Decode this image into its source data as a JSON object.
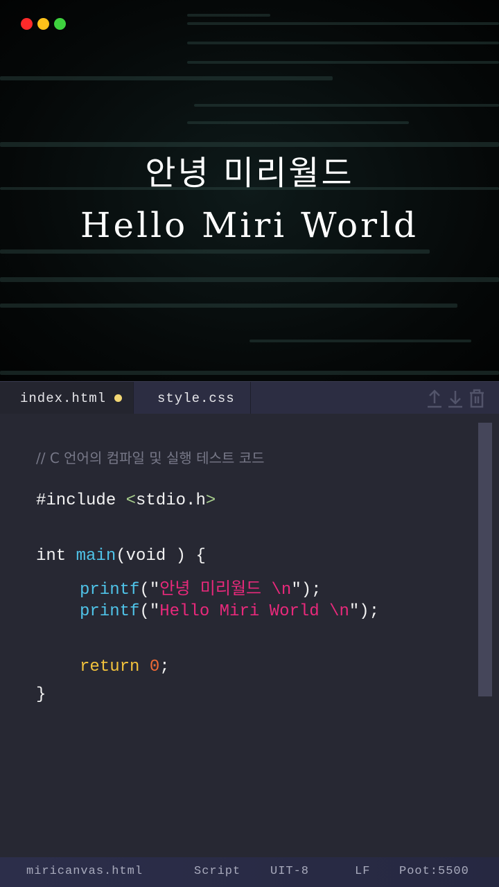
{
  "window": {
    "controls": [
      {
        "name": "close",
        "color": "#ff2a2a"
      },
      {
        "name": "minimize",
        "color": "#ffc21a"
      },
      {
        "name": "maximize",
        "color": "#3ed23e"
      }
    ]
  },
  "hero": {
    "title_ko": "안녕 미리월드",
    "title_en": "Hello Miri World"
  },
  "tabs": [
    {
      "label": "index.html",
      "modified": true
    },
    {
      "label": "style.css",
      "modified": false
    }
  ],
  "toolbar": {
    "icons": [
      "upload-icon",
      "download-icon",
      "trash-icon"
    ]
  },
  "code": {
    "comment": "// C 언어의 컴파일 및 실행 테스트 코드",
    "include_kw": "#include ",
    "include_open": "<",
    "include_file": "stdio.h",
    "include_close": ">",
    "int_kw": "int ",
    "main_fn": "main",
    "main_rest": "(void ) {",
    "printf1_fn": "printf",
    "printf1_open": "(\"",
    "printf1_str": "안녕 미리월드 \\n",
    "printf1_close": "\");",
    "printf2_fn": "printf",
    "printf2_open": "(\"",
    "printf2_str": "Hello Miri World \\n",
    "printf2_close": "\");",
    "return_kw": "return ",
    "return_val": "0",
    "return_semi": ";",
    "close_brace": "}"
  },
  "colors": {
    "keyword_blue": "#4fc3e8",
    "string_pink": "#e8297b",
    "return_yellow": "#f2c23c",
    "number_orange": "#ef6a35",
    "include_green": "#a9d08e"
  },
  "status_bar": {
    "file": "miricanvas.html",
    "language": "Script",
    "encoding": "UIT-8",
    "line_ending": "LF",
    "port": "Poot:5500"
  }
}
